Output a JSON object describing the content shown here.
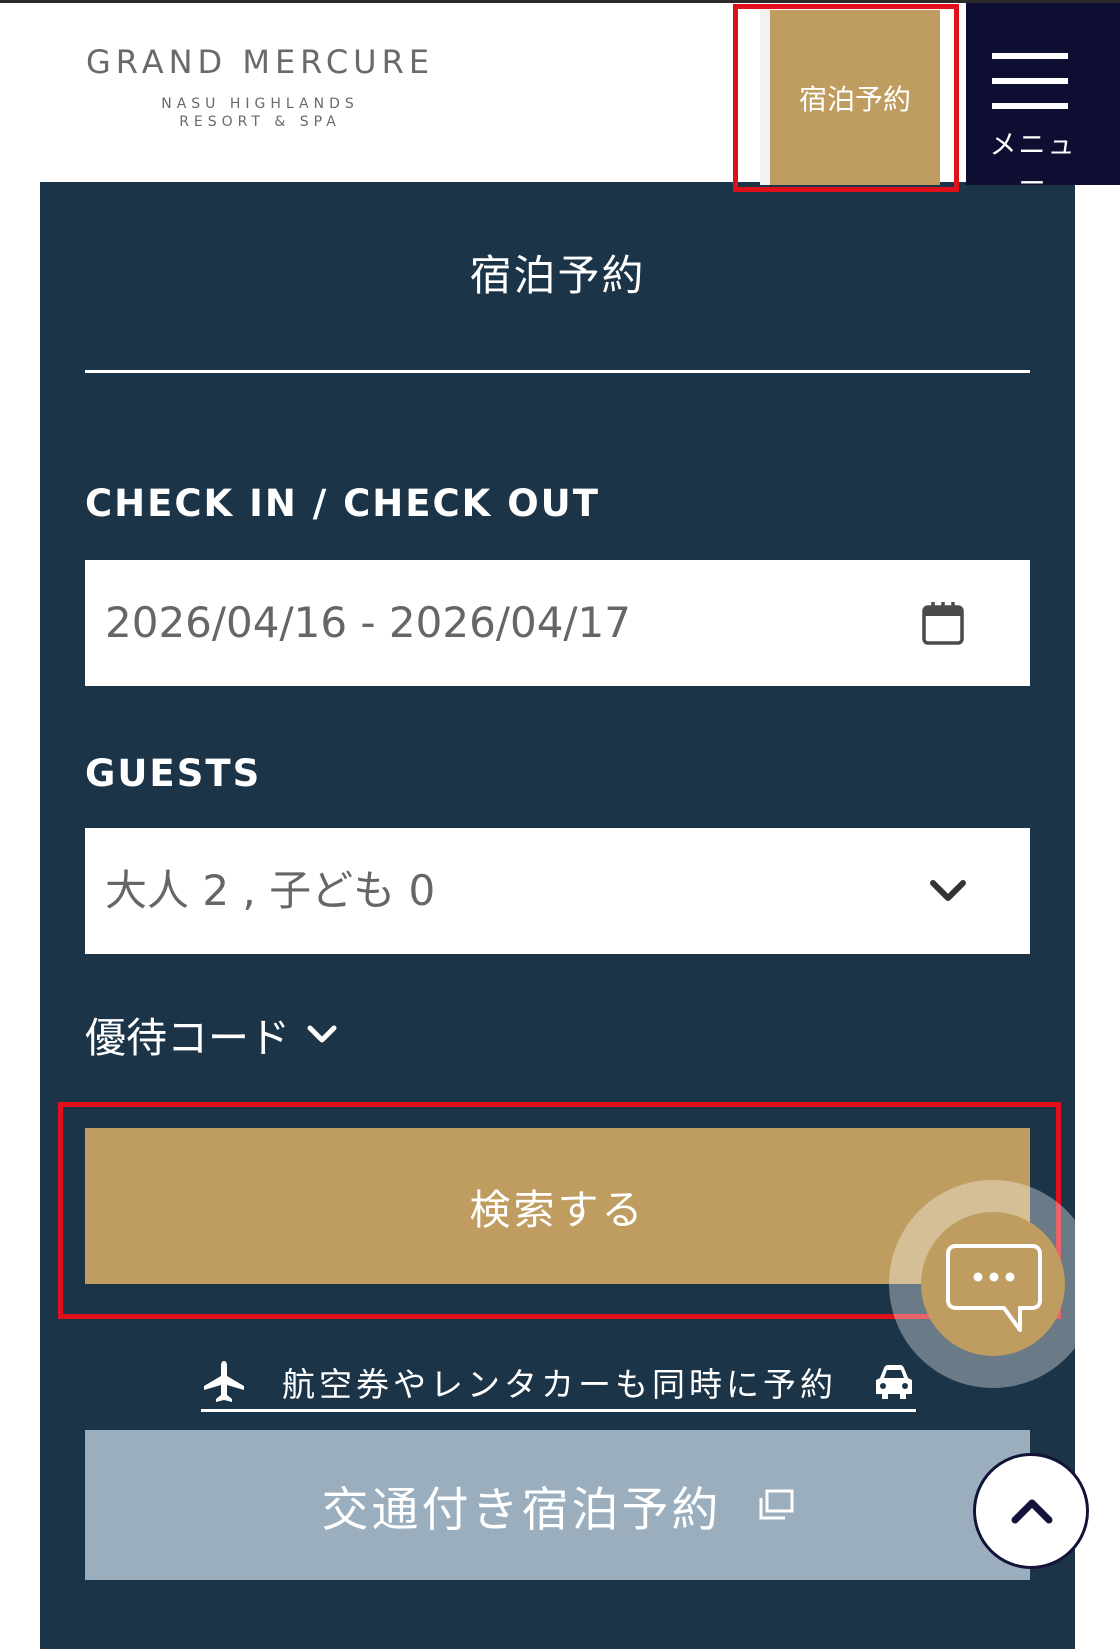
{
  "header": {
    "logo": {
      "main": "GRAND MERCURE",
      "sub1": "NASU HIGHLANDS",
      "sub2": "RESORT & SPA"
    },
    "book_label": "宿泊予約",
    "menu_label": "メニュー"
  },
  "booking": {
    "title": "宿泊予約",
    "checkin_label": "CHECK IN / CHECK OUT",
    "date_value": "2026/04/16 - 2026/04/17",
    "guests_label": "GUESTS",
    "guests_value": "大人 2 , 子ども 0",
    "promo_label": "優待コード",
    "search_label": "検索する",
    "combo_link_label": "航空券やレンタカーも同時に予約",
    "transport_label": "交通付き宿泊予約"
  },
  "colors": {
    "gold": "#bf9d60",
    "navy_panel": "#1b3448",
    "menu_bg": "#0e0e33",
    "highlight_red": "#e0101b",
    "transport_btn": "#9aaebd"
  },
  "icons": {
    "menu": "hamburger-icon",
    "calendar": "calendar-icon",
    "guests_dropdown": "chevron-down-icon",
    "promo_toggle": "chevron-down-icon",
    "plane": "airplane-icon",
    "car": "car-icon",
    "external": "external-window-icon",
    "chat": "chat-bubble-icon",
    "back_to_top": "chevron-up-icon"
  }
}
